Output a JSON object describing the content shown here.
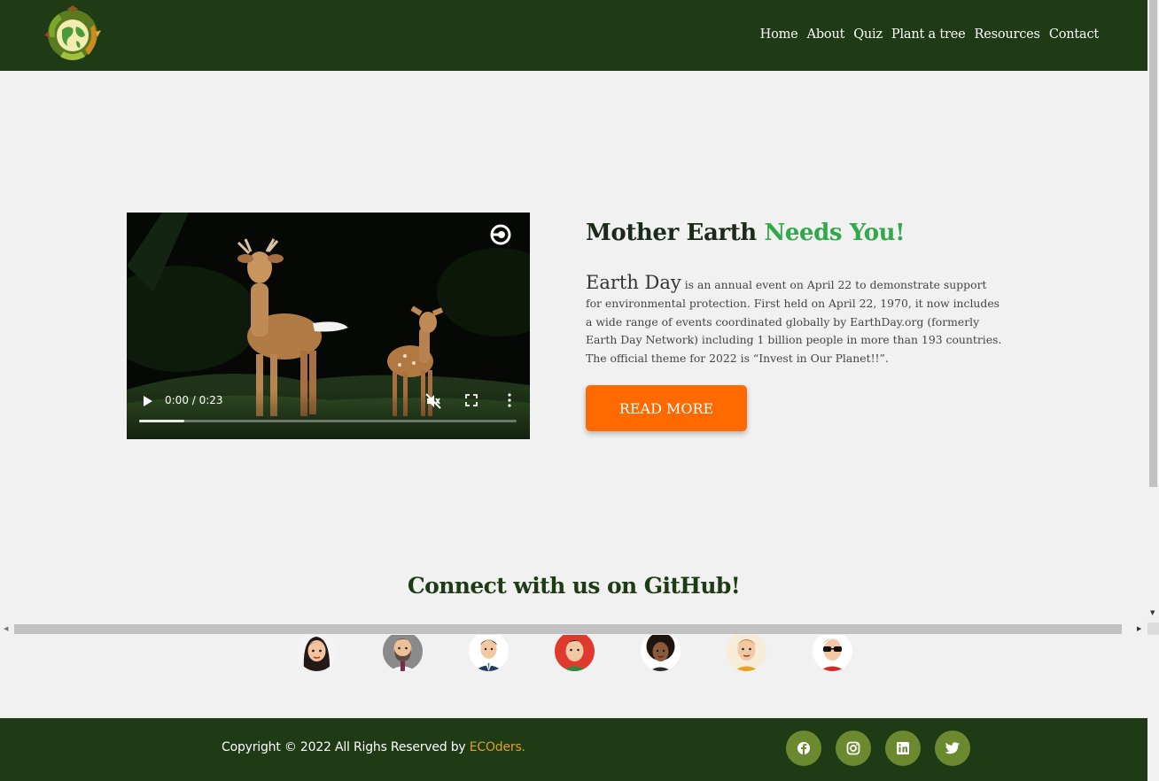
{
  "nav": {
    "logo_name": "earth-logo",
    "items": [
      {
        "label": "Home"
      },
      {
        "label": "About"
      },
      {
        "label": "Quiz"
      },
      {
        "label": "Plant a tree"
      },
      {
        "label": "Resources"
      },
      {
        "label": "Contact"
      }
    ]
  },
  "hero": {
    "title_main": "Mother Earth",
    "title_accent": "Needs You!",
    "lead": "Earth Day",
    "body": " is an annual event on April 22 to demonstrate support for environmental protection. First held on April 22, 1970, it now includes a wide range of events coordinated globally by EarthDay.org (formerly Earth Day Network) including 1 billion people in more than 193 countries. The official theme for 2022 is “Invest in Our Planet!!”.",
    "button_label": "READ MORE",
    "video": {
      "time": "0:00 / 0:23",
      "progress_fraction": 0.12,
      "muted": true
    }
  },
  "github": {
    "title": "Connect with us on GitHub!",
    "avatars": [
      {
        "name": "avatar-woman-dark-hair"
      },
      {
        "name": "avatar-man-beard"
      },
      {
        "name": "avatar-man-suit"
      },
      {
        "name": "avatar-man-red-bg"
      },
      {
        "name": "avatar-woman-afro"
      },
      {
        "name": "avatar-man-blond"
      },
      {
        "name": "avatar-man-sunglasses"
      }
    ]
  },
  "footer": {
    "copyright": "Copyright © 2022 All Righs Reserved by ",
    "brand": "ECOders.",
    "socials": [
      {
        "name": "facebook-icon"
      },
      {
        "name": "instagram-icon"
      },
      {
        "name": "linkedin-icon"
      },
      {
        "name": "twitter-icon"
      }
    ]
  },
  "colors": {
    "nav_bg": "#1e3b16",
    "accent_green": "#33a84a",
    "button_orange": "#ff6a00",
    "social_bg": "#6b8a30",
    "brand_gold": "#e0a020"
  }
}
